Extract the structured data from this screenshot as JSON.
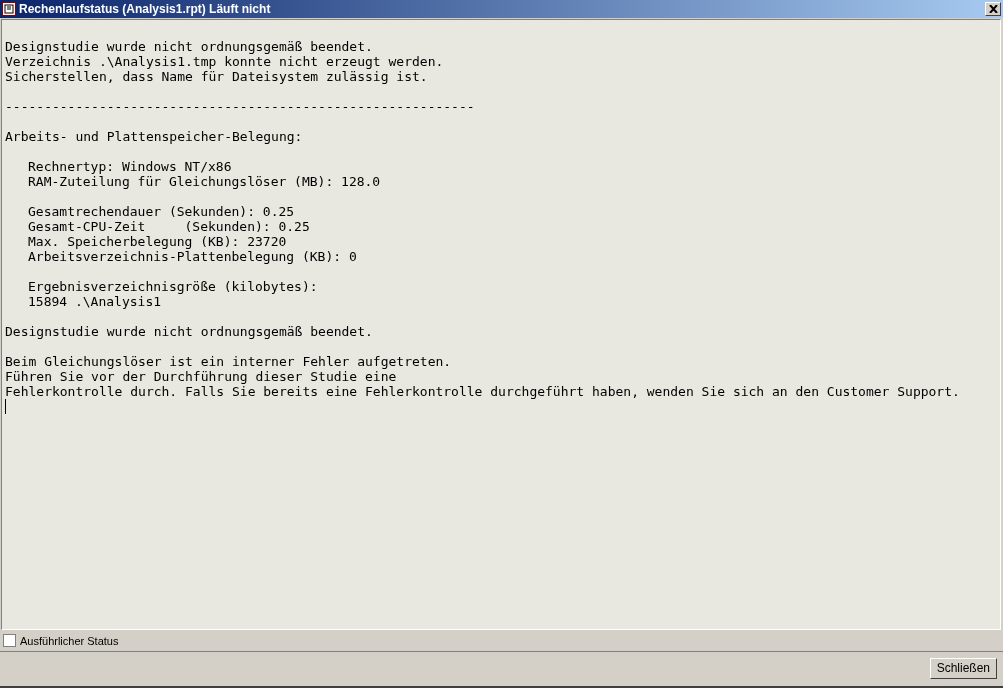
{
  "window": {
    "title": "Rechenlaufstatus (Analysis1.rpt) Läuft nicht"
  },
  "log": [
    {
      "indented": false,
      "lines": [
        "Designstudie wurde nicht ordnungsgemäß beendet.",
        "Verzeichnis .\\Analysis1.tmp konnte nicht erzeugt werden.",
        "Sicherstellen, dass Name für Dateisystem zulässig ist."
      ]
    },
    {
      "indented": false,
      "lines": [
        "------------------------------------------------------------"
      ]
    },
    {
      "indented": false,
      "lines": [
        "Arbeits- und Plattenspeicher-Belegung:"
      ]
    },
    {
      "indented": true,
      "lines": [
        "Rechnertyp: Windows NT/x86",
        "RAM-Zuteilung für Gleichungslöser (MB): 128.0"
      ]
    },
    {
      "indented": true,
      "lines": [
        "Gesamtrechendauer (Sekunden): 0.25",
        "Gesamt-CPU-Zeit     (Sekunden): 0.25",
        "Max. Speicherbelegung (KB): 23720",
        "Arbeitsverzeichnis-Plattenbelegung (KB): 0"
      ]
    },
    {
      "indented": true,
      "lines": [
        "Ergebnisverzeichnisgröße (kilobytes):",
        "15894 .\\Analysis1"
      ]
    },
    {
      "indented": false,
      "lines": [
        "Designstudie wurde nicht ordnungsgemäß beendet."
      ]
    },
    {
      "indented": false,
      "lines": [
        "Beim Gleichungslöser ist ein interner Fehler aufgetreten.",
        "Führen Sie vor der Durchführung dieser Studie eine",
        "Fehlerkontrolle durch. Falls Sie bereits eine Fehlerkontrolle durchgeführt haben, wenden Sie sich an den Customer Support."
      ]
    }
  ],
  "detailed_status": {
    "label": "Ausführlicher Status",
    "checked": false
  },
  "buttons": [
    "Schließen"
  ]
}
